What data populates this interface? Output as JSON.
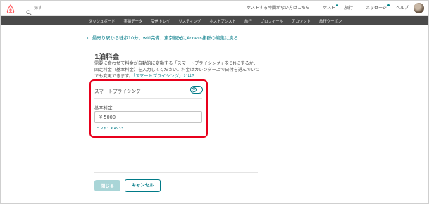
{
  "header": {
    "search_placeholder": "探す",
    "nav_items": [
      "ホストする時間がない方はこちら",
      "ホスト",
      "旅行",
      "メッセージ",
      "ヘルプ"
    ]
  },
  "subnav": {
    "items": [
      "ダッシュボード",
      "実績データ",
      "受信トレイ",
      "リスティング",
      "ホストアシスト",
      "旅行",
      "プロフィール",
      "アカウント",
      "旅行クーポン"
    ]
  },
  "back_link": "最寄り駅から徒歩10分、wifi完備、東京観光にAccess抜群の編集に戻る",
  "page": {
    "title": "1泊料金",
    "description": "需要に合わせて料金が自動的に変動する「スマートプライシング」をONにするか、固定料金（基本料金）を入力してください。料金はカレンダー上で日付を選んでいつでも変更できます。",
    "description_link": "「スマートプライシング」とは？"
  },
  "smart_pricing": {
    "label": "スマートプライシング",
    "toggle_symbol": "×"
  },
  "base_price": {
    "label": "基本料金",
    "value": "¥  5000",
    "hint": "ヒント：¥ 4933"
  },
  "buttons": {
    "close": "閉じる",
    "cancel": "キャンセル"
  },
  "colors": {
    "accent": "#007a87",
    "highlight": "#e8001c",
    "subnav_bg": "#4a4a4a",
    "logo": "#ff5a5f"
  }
}
